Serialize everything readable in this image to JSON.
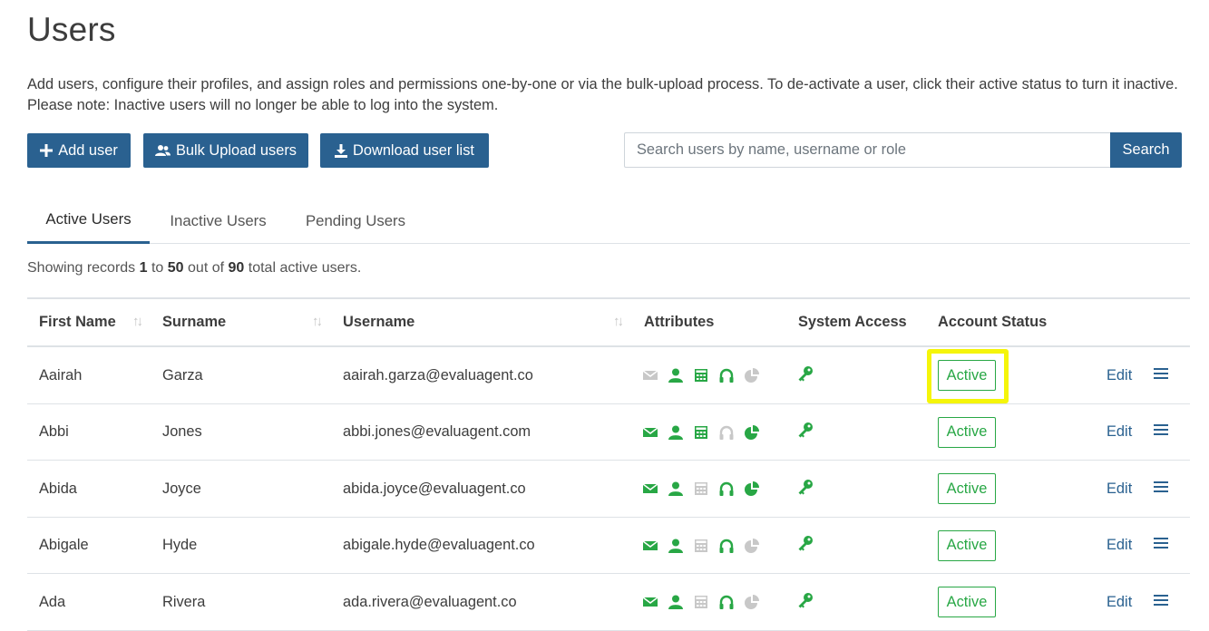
{
  "page": {
    "title": "Users",
    "description": "Add users, configure their profiles, and assign roles and permissions one-by-one or via the bulk-upload process. To de-activate a user, click their active status to turn it inactive. Please note: Inactive users will no longer be able to log into the system."
  },
  "toolbar": {
    "add_label": "Add user",
    "bulk_label": "Bulk Upload users",
    "download_label": "Download user list"
  },
  "search": {
    "placeholder": "Search users by name, username or role",
    "button_label": "Search"
  },
  "tabs": [
    {
      "label": "Active Users",
      "active": true
    },
    {
      "label": "Inactive Users",
      "active": false
    },
    {
      "label": "Pending Users",
      "active": false
    }
  ],
  "records": {
    "prefix": "Showing records",
    "from": "1",
    "to_word": "to",
    "to": "50",
    "out_of_word": "out of",
    "total": "90",
    "suffix": "total active users."
  },
  "table": {
    "headers": {
      "first_name": "First Name",
      "surname": "Surname",
      "username": "Username",
      "attributes": "Attributes",
      "system_access": "System Access",
      "account_status": "Account Status"
    },
    "sort_glyph": "↑↓",
    "rows": [
      {
        "first": "Aairah",
        "surname": "Garza",
        "username": "aairah.garza@evaluagent.co",
        "status": "Active",
        "edit": "Edit",
        "attrs": {
          "email": false,
          "user": true,
          "calc": true,
          "headset": true,
          "pie": false
        },
        "highlighted": true
      },
      {
        "first": "Abbi",
        "surname": "Jones",
        "username": "abbi.jones@evaluagent.com",
        "status": "Active",
        "edit": "Edit",
        "attrs": {
          "email": true,
          "user": true,
          "calc": true,
          "headset": false,
          "pie": true
        },
        "highlighted": false
      },
      {
        "first": "Abida",
        "surname": "Joyce",
        "username": "abida.joyce@evaluagent.co",
        "status": "Active",
        "edit": "Edit",
        "attrs": {
          "email": true,
          "user": true,
          "calc": false,
          "headset": true,
          "pie": true
        },
        "highlighted": false
      },
      {
        "first": "Abigale",
        "surname": "Hyde",
        "username": "abigale.hyde@evaluagent.co",
        "status": "Active",
        "edit": "Edit",
        "attrs": {
          "email": true,
          "user": true,
          "calc": false,
          "headset": true,
          "pie": false
        },
        "highlighted": false
      },
      {
        "first": "Ada",
        "surname": "Rivera",
        "username": "ada.rivera@evaluagent.co",
        "status": "Active",
        "edit": "Edit",
        "attrs": {
          "email": true,
          "user": true,
          "calc": false,
          "headset": true,
          "pie": false
        },
        "highlighted": false
      }
    ]
  },
  "colors": {
    "primary": "#2a6190",
    "attr_on": "#28a745",
    "attr_off": "#c8c8c8",
    "status_green": "#28a745",
    "highlight": "#f5f50a"
  },
  "icons": {
    "add": "plus-icon",
    "bulk": "users-icon",
    "download": "download-icon",
    "attributes": [
      "envelope-icon",
      "user-icon",
      "calculator-icon",
      "headset-icon",
      "pie-chart-icon"
    ],
    "system_access": "key-icon",
    "row_menu": "hamburger-menu-icon"
  }
}
